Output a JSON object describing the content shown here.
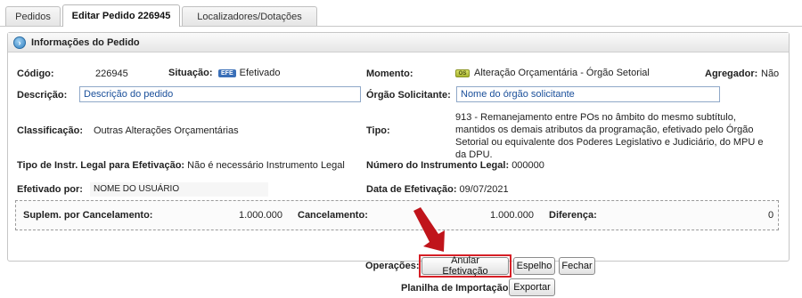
{
  "tabs": [
    {
      "label": "Pedidos"
    },
    {
      "label": "Editar Pedido 226945"
    },
    {
      "label": "Localizadores/Dotações"
    }
  ],
  "panel": {
    "title": "Informações do Pedido",
    "icon": "info-icon"
  },
  "fields": {
    "codigo_label": "Código:",
    "codigo_value": "226945",
    "situacao_label": "Situação:",
    "situacao_badge": "EFE",
    "situacao_value": "Efetivado",
    "momento_label": "Momento:",
    "momento_icon_text": "OS",
    "momento_value": "Alteração Orçamentária - Órgão Setorial",
    "agregador_label": "Agregador:",
    "agregador_value": "Não",
    "descricao_label": "Descrição:",
    "descricao_value": "Descrição do pedido",
    "orgao_label": "Órgão Solicitante:",
    "orgao_value": "Nome do órgão solicitante",
    "classificacao_label": "Classificação:",
    "classificacao_value": "Outras Alterações Orçamentárias",
    "tipo_label": "Tipo:",
    "tipo_value": "913 - Remanejamento entre POs no âmbito do mesmo subtítulo, mantidos os demais atributos da programação, efetivado pelo Órgão Setorial ou equivalente dos Poderes Legislativo e Judiciário, do MPU e da DPU.",
    "tipo_instr_label": "Tipo de Instr. Legal para Efetivação:",
    "tipo_instr_value": "Não é necessário Instrumento Legal",
    "numero_instr_label": "Número do Instrumento Legal:",
    "numero_instr_value": "000000",
    "efetivado_por_label": "Efetivado por:",
    "efetivado_por_value": "NOME DO USUÁRIO",
    "data_efet_label": "Data de Efetivação:",
    "data_efet_value": "09/07/2021"
  },
  "totals": {
    "suplem_label": "Suplem. por Cancelamento:",
    "suplem_value": "1.000.000",
    "cancel_label": "Cancelamento:",
    "cancel_value": "1.000.000",
    "diferenca_label": "Diferença:",
    "diferenca_value": "0"
  },
  "operations": {
    "label": "Operações:",
    "anular": "Anular Efetivação",
    "espelho": "Espelho",
    "fechar": "Fechar",
    "planilha_label": "Planilha de Importação:",
    "exportar": "Exportar"
  },
  "colors": {
    "highlight": "#d61f26",
    "arrow": "#c0141b",
    "input_text": "#1a4f9a"
  }
}
